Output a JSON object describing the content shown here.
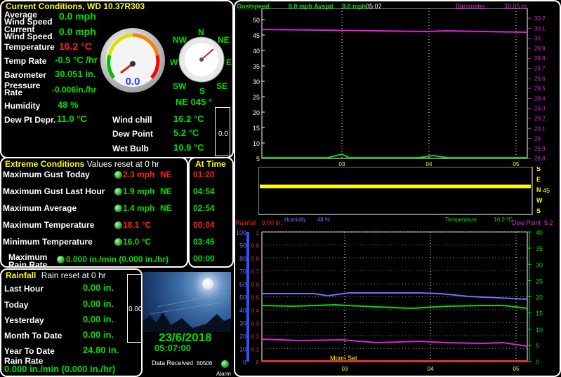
{
  "current": {
    "title": "Current Conditions, WD 10.37R303",
    "avg_wind_label": "Average\nWind Speed",
    "avg_wind": "0.0 mph",
    "cur_wind_label": "Current\nWind Speed",
    "cur_wind": "0.0 mph",
    "temp_label": "Temperature",
    "temp": "16.2 °C",
    "temp_rate_label": "Temp Rate",
    "temp_rate": "-0.5 °C /hr",
    "baro_label": "Barometer",
    "baro": "30.051 in.",
    "pressure_rate_label": "Pressure\nRate",
    "pressure_rate": "-0.006in./hr",
    "humidity_label": "Humidity",
    "humidity": "48 %",
    "dewdepr_label": "Dew Pt Depr.",
    "dewdepr": "11.0 °C",
    "windchill_label": "Wind chill",
    "windchill": "16.2 °C",
    "dewpoint_label": "Dew Point",
    "dewpoint": "5.2 °C",
    "wetbulb_label": "Wet Bulb",
    "wetbulb": "10.9 °C",
    "gauge_value": "0.0",
    "wind_dir": "NE 045 °",
    "side_value": "0.0",
    "compass": {
      "N": "N",
      "NE": "NE",
      "E": "E",
      "SE": "SE",
      "S": "S",
      "SW": "SW",
      "W": "W",
      "NW": "NW"
    }
  },
  "extreme": {
    "title": "Extreme Conditions",
    "reset": "Values reset at 0 hr",
    "at_time_title": "At Time",
    "rows": [
      {
        "label": "Maximum Gust Today",
        "value": "2.3 mph",
        "dir": "NE",
        "time": "01:20"
      },
      {
        "label": "Maximum Gust Last Hour",
        "value": "1.9 mph",
        "dir": "NE",
        "time": "04:54"
      },
      {
        "label": "Maximum Average",
        "value": "1.4 mph",
        "dir": "NE",
        "time": "02:54"
      },
      {
        "label": "Maximum Temperature",
        "value": "18.1 °C",
        "dir": "",
        "time": "00:04"
      },
      {
        "label": "Minimum Temperature",
        "value": "16.0 °C",
        "dir": "",
        "time": "03:45"
      },
      {
        "label": "Maximum\nRain Rate",
        "value": "0.000 in./min (0.000 in./hr)",
        "dir": "",
        "time": "00:00"
      }
    ]
  },
  "rainfall": {
    "title": "Rainfall",
    "reset": "Rain reset at 0 hr",
    "last_hour_label": "Last Hour",
    "last_hour": "0.00 in.",
    "today_label": "Today",
    "today": "0.00 in.",
    "yesterday_label": "Yesterday",
    "yesterday": "0.00 in.",
    "month_label": "Month To Date",
    "month": "0.00 in.",
    "year_label": "Year To Date",
    "year": "24.80 in.",
    "rate_label": "Rain Rate",
    "rate": "0.000 in./min (0.000 in./hr)",
    "side_value": "0.00"
  },
  "status": {
    "date": "23/6/2018",
    "time": "05:07:00",
    "data_received_label": "Data Received",
    "data_received": "60506",
    "alarm_label": "Alarm"
  },
  "graph_top": {
    "gust_label": "Gustspeed",
    "avg_label": "0.0 mph Avspd",
    "gust_val": "0.0 mph",
    "time": "05:07",
    "baro_label": "Barometer",
    "baro_val": "30.05 in.",
    "left_ticks": [
      "50",
      "45",
      "40",
      "35",
      "30",
      "25",
      "20",
      "15",
      "10",
      "5"
    ],
    "right_ticks": [
      "30.2",
      "30.1",
      "30",
      "29.9",
      "29.8",
      "29.7",
      "29.6",
      "29.5",
      "29.4",
      "29.3",
      "29.2",
      "29.1",
      "29",
      "28.9",
      "28.8"
    ],
    "x_ticks": [
      "03",
      "04",
      "05"
    ]
  },
  "wind_dir_graph": {
    "labels": [
      "S",
      "E",
      "N",
      "W",
      "S"
    ],
    "value": "45"
  },
  "graph_bottom": {
    "rain_label": "Rainfall",
    "rain_val": "0.00 in.",
    "hum_label": "Humidity",
    "hum_val": "48 %",
    "temp_label": "Temperature",
    "temp_val": "16.2 °C",
    "dew_label": "Dew Point",
    "dew_val": "5.2",
    "left_ticks": [
      "100",
      "90",
      "80",
      "70",
      "60",
      "50",
      "40",
      "30",
      "20",
      "10",
      "0"
    ],
    "rain_ticks": [
      "1",
      "0.9",
      "0.8",
      "0.7",
      "0.6",
      "0.5",
      "0.4",
      "0.3",
      "0.2",
      "0.1",
      "0"
    ],
    "right_ticks": [
      "40",
      "35",
      "30",
      "25",
      "20",
      "15",
      "10",
      "5",
      "0"
    ],
    "x_ticks": [
      "03",
      "04",
      "05"
    ],
    "moon_set": "Moon Set"
  },
  "colors": {
    "green": "#00e000",
    "red": "#ff2020",
    "yellow": "#ffff00",
    "magenta": "#e020e0",
    "blue": "#7070ff"
  }
}
